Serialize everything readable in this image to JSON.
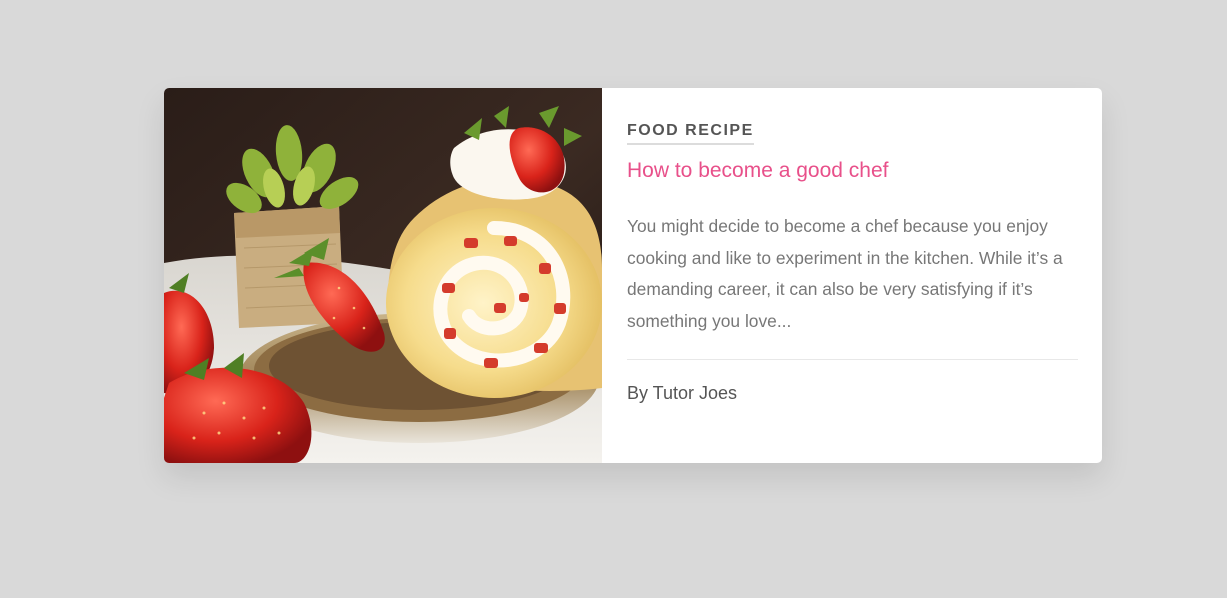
{
  "card": {
    "category": "FOOD RECIPE",
    "title": "How to become a good chef",
    "excerpt": "You might decide to become a chef because you enjoy cooking and like to experiment in the kitchen. While it’s a demanding career, it can also be very satisfying if it’s something you love...",
    "author": "By Tutor Joes",
    "image_icon": "strawberry-roll-cake-photo"
  },
  "colors": {
    "background": "#d9d9d9",
    "card": "#ffffff",
    "title_accent": "#e8508a",
    "category_text": "#555555",
    "body_text": "#777777"
  }
}
